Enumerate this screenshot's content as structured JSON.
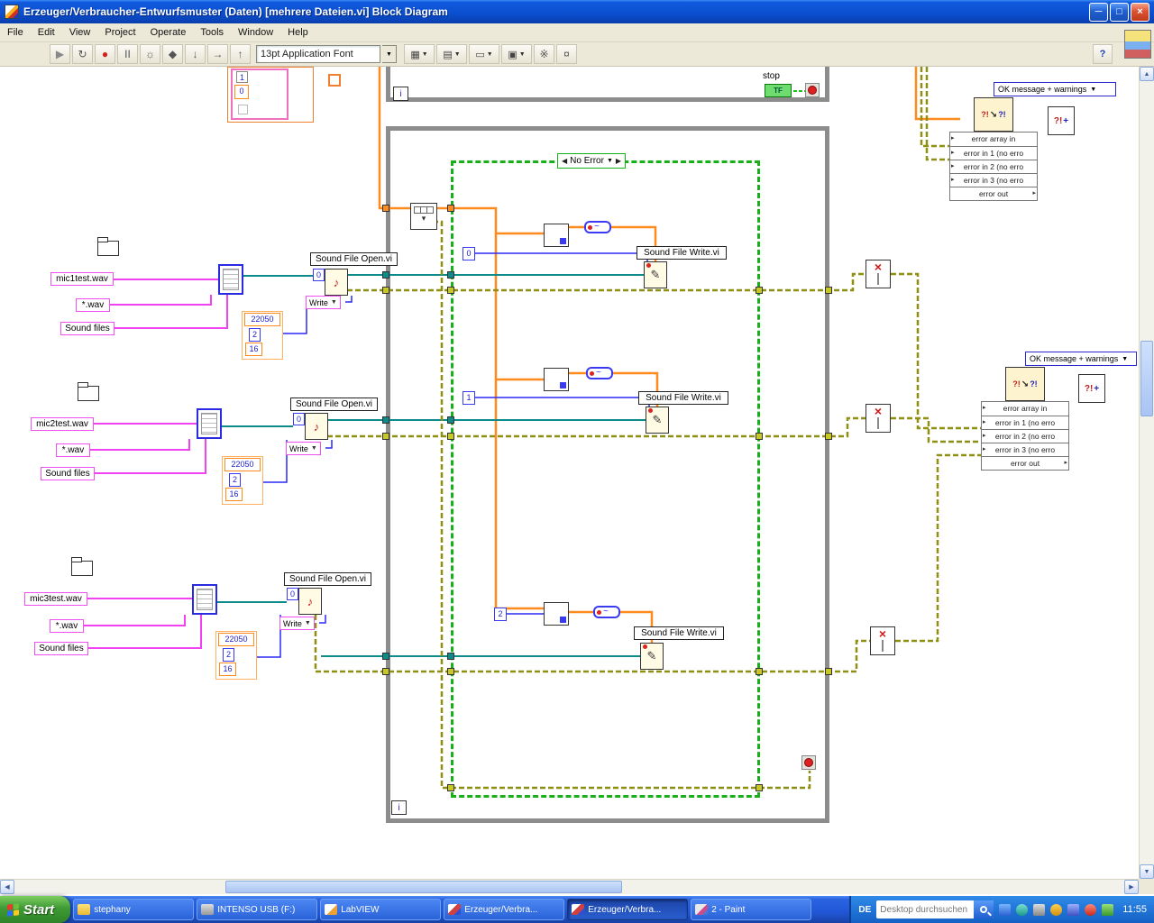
{
  "window": {
    "title": "Erzeuger/Verbraucher-Entwurfsmuster (Daten) [mehrere Dateien.vi] Block Diagram",
    "controls": {
      "minimize": "─",
      "maximize": "□",
      "close": "×"
    }
  },
  "menu": {
    "items": [
      "File",
      "Edit",
      "View",
      "Project",
      "Operate",
      "Tools",
      "Window",
      "Help"
    ]
  },
  "toolbar": {
    "buttons": [
      {
        "name": "run",
        "glyph": "▶"
      },
      {
        "name": "run-continuous",
        "glyph": "↻"
      },
      {
        "name": "abort",
        "glyph": "●"
      },
      {
        "name": "pause",
        "glyph": "II"
      },
      {
        "name": "highlight-execution",
        "glyph": "☼"
      },
      {
        "name": "retain-wire-values",
        "glyph": "◆"
      },
      {
        "name": "step-into",
        "glyph": "↓"
      },
      {
        "name": "step-over",
        "glyph": "→"
      },
      {
        "name": "step-out",
        "glyph": "↑"
      }
    ],
    "font_selector": "13pt Application Font",
    "dropdowns": [
      {
        "name": "align-objects",
        "glyph": "▦"
      },
      {
        "name": "distribute-objects",
        "glyph": "▤"
      },
      {
        "name": "resize-objects",
        "glyph": "▭"
      },
      {
        "name": "reorder",
        "glyph": "▣"
      }
    ],
    "extras": [
      {
        "name": "clean-up-diagram",
        "glyph": "※"
      },
      {
        "name": "diagram-tool",
        "glyph": "¤"
      }
    ],
    "help_label": "?"
  },
  "diagram": {
    "fragment": {
      "val1": "1",
      "val0": "0"
    },
    "producer_loop": {
      "iteration_label": "i",
      "stop_label": "stop",
      "stop_value": "TF"
    },
    "consumer_loop": {
      "iteration_label": "i"
    },
    "case_structure": {
      "selector": "No Error"
    },
    "branches": [
      {
        "index_const": "0",
        "write_label": "Sound File Write.vi"
      },
      {
        "index_const": "1",
        "write_label": "Sound File Write.vi"
      },
      {
        "index_const": "2",
        "write_label": "Sound File Write.vi"
      }
    ],
    "file_groups": [
      {
        "filename": "mic1test.wav",
        "pattern": "*.wav",
        "prompt": "Sound files",
        "open_label": "Sound File Open.vi",
        "zero": "0",
        "mode": "Write",
        "sample_rate": "22050",
        "channels": "2",
        "bits": "16"
      },
      {
        "filename": "mic2test.wav",
        "pattern": "*.wav",
        "prompt": "Sound files",
        "open_label": "Sound File Open.vi",
        "zero": "0",
        "mode": "Write",
        "sample_rate": "22050",
        "channels": "2",
        "bits": "16"
      },
      {
        "filename": "mic3test.wav",
        "pattern": "*.wav",
        "prompt": "Sound files",
        "open_label": "Sound File Open.vi",
        "zero": "0",
        "mode": "Write",
        "sample_rate": "22050",
        "channels": "2",
        "bits": "16"
      }
    ],
    "error_handler_top": {
      "selector_label": "OK message + warnings",
      "rows": [
        "error array in",
        "error in 1 (no erro",
        "error in 2 (no erro",
        "error in 3 (no erro",
        "error out"
      ]
    },
    "error_handler_right": {
      "selector_label": "OK message + warnings",
      "rows": [
        "error array in",
        "error in 1 (no erro",
        "error in 2 (no erro",
        "error in 3 (no erro",
        "error out"
      ]
    }
  },
  "icons": {
    "error_glyph": "?!",
    "diag_arrow": "↘",
    "pencil": "✎",
    "note": "♪",
    "close_x": "×",
    "plus": "+"
  },
  "taskbar": {
    "start_label": "Start",
    "tasks": [
      {
        "label": "stephany"
      },
      {
        "label": "INTENSO USB (F:)"
      },
      {
        "label": "LabVIEW"
      },
      {
        "label": "Erzeuger/Verbra..."
      },
      {
        "label": "Erzeuger/Verbra..."
      },
      {
        "label": "2 - Paint"
      }
    ],
    "language": "DE",
    "search_placeholder": "Desktop durchsuchen",
    "clock": "11:55"
  }
}
